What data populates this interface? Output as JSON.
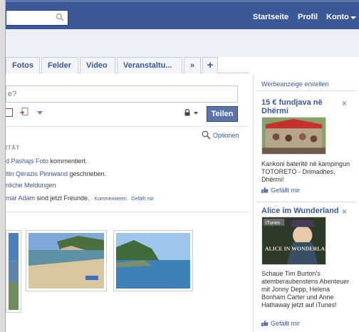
{
  "topbar": {
    "search_placeholder": "",
    "nav_home": "Startseite",
    "nav_profile": "Profil",
    "nav_account": "Konto"
  },
  "tabs": {
    "fotos": "Fotos",
    "felder": "Felder",
    "video": "Video",
    "veranstaltungen": "Veranstaltu...",
    "more": "»",
    "add": "+"
  },
  "composer": {
    "placeholder_fragment": "e?",
    "share_label": "Teilen"
  },
  "feed": {
    "options_label": "Optionen",
    "section_heading": "ITÄT",
    "items": [
      {
        "link": "d Pashajs Foto",
        "text": " kommentiert."
      },
      {
        "link": "ltin Qerazis Pinnwand",
        "text": " geschrieben."
      },
      {
        "link": "nliche Meldungen",
        "text": ""
      },
      {
        "link": "mar Adam",
        "text": " sind jetzt Freunde.",
        "comment": "Kommentieren",
        "like": "Gefällt mir"
      }
    ]
  },
  "sidebar": {
    "create_ad": "Werbeanzeige erstellen",
    "ads": [
      {
        "title": "15 € fundjava në Dhërmi",
        "text": "Karikoni bateritë në kampingun TOTORETO - Drimadhes, Dhërmi!",
        "like": "Gefällt mir",
        "close": "×"
      },
      {
        "title": "Alice im Wunderland",
        "image_text_1": "iTunes",
        "image_text_2": "ALICE IN WONDERLAND",
        "text": "Schaue Tim Burton's atemberaubenstens Abenteuer mit Jonny Depp, Helena Bonham Carter und Anne Hathaway jetzt auf iTunes!",
        "like": "Gefällt mir",
        "close": "×"
      }
    ]
  },
  "colors": {
    "brand_blue": "#3b5998",
    "band_gray": "#eceff5",
    "link_blue": "#3b5998"
  }
}
